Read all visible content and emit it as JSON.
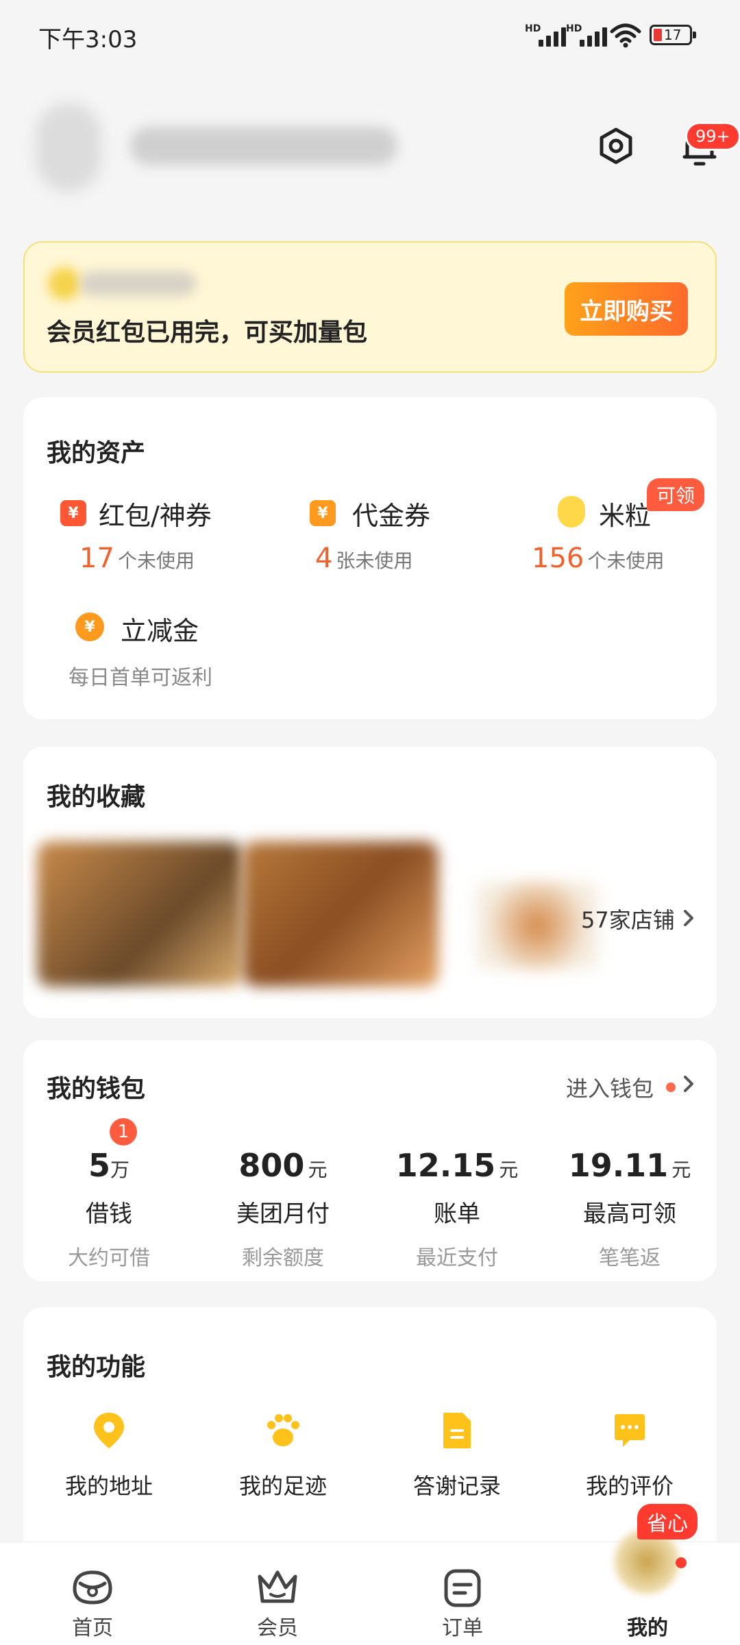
{
  "status_bar": {
    "time": "下午3:03",
    "signal1": "HD",
    "signal2": "HD",
    "battery": "17"
  },
  "header": {
    "notification_badge": "99+"
  },
  "vip_banner": {
    "text": "会员红包已用完，可买加量包",
    "button": "立即购买"
  },
  "assets": {
    "title": "我的资产",
    "items": [
      {
        "label": "红包/神券",
        "count": "17",
        "unit": "个未使用",
        "icon": "red-packet-icon"
      },
      {
        "label": "代金券",
        "count": "4",
        "unit": "张未使用",
        "icon": "voucher-icon"
      },
      {
        "label": "米粒",
        "count": "156",
        "unit": "个未使用",
        "icon": "rice-grain-icon",
        "tag": "可领"
      },
      {
        "label": "立减金",
        "sub": "每日首单可返利",
        "icon": "discount-coin-icon"
      }
    ]
  },
  "favorites": {
    "title": "我的收藏",
    "stores": "57家店铺"
  },
  "wallet": {
    "title": "我的钱包",
    "enter": "进入钱包",
    "items": [
      {
        "value": "5",
        "unit": "万",
        "label": "借钱",
        "sub": "大约可借",
        "badge": "1"
      },
      {
        "value": "800",
        "unit": "元",
        "label": "美团月付",
        "sub": "剩余额度"
      },
      {
        "value": "12.15",
        "unit": "元",
        "label": "账单",
        "sub": "最近支付"
      },
      {
        "value": "19.11",
        "unit": "元",
        "label": "最高可领",
        "sub": "笔笔返"
      }
    ]
  },
  "functions": {
    "title": "我的功能",
    "items": [
      {
        "label": "我的地址",
        "icon": "location-pin-icon"
      },
      {
        "label": "我的足迹",
        "icon": "paw-print-icon"
      },
      {
        "label": "答谢记录",
        "icon": "document-icon"
      },
      {
        "label": "我的评价",
        "icon": "comment-icon"
      }
    ],
    "promo_tag": "省心"
  },
  "tabs": [
    {
      "label": "首页",
      "icon": "home-icon"
    },
    {
      "label": "会员",
      "icon": "crown-icon"
    },
    {
      "label": "订单",
      "icon": "order-icon"
    },
    {
      "label": "我的",
      "icon": "profile-icon"
    }
  ],
  "colors": {
    "accent": "#FFC21A",
    "orange": "#F0622D",
    "banner_bg": "#FFF7D6"
  }
}
